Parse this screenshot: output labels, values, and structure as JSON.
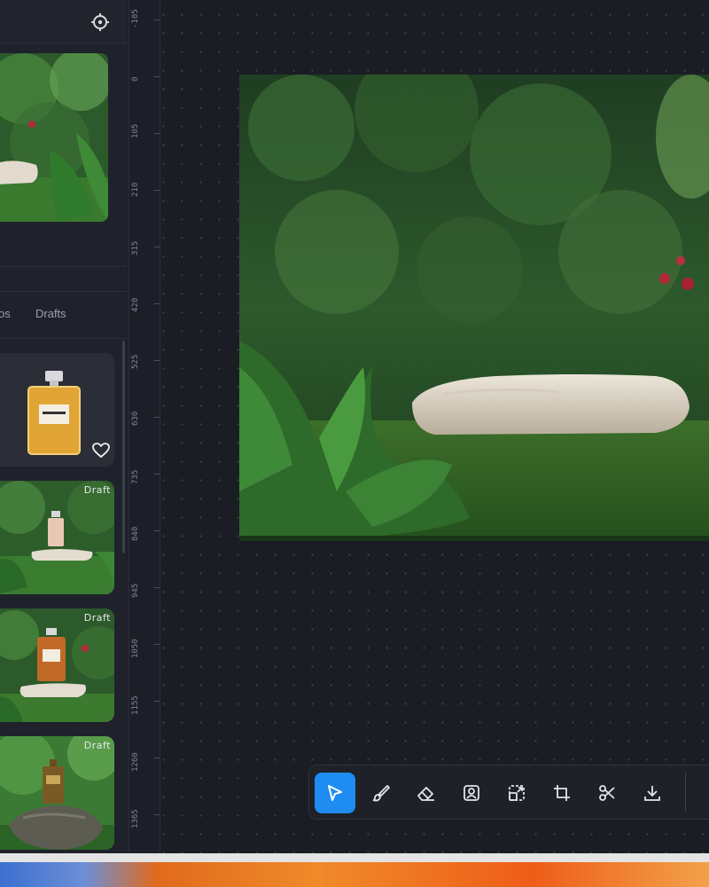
{
  "left_panel": {
    "tabs": [
      "os",
      "Drafts"
    ],
    "cards": [
      {
        "badge": "",
        "favorite_icon": "heart-icon",
        "product": "perfume-bottle"
      },
      {
        "badge": "Draft"
      },
      {
        "badge": "Draft"
      },
      {
        "badge": "Draft"
      }
    ]
  },
  "ruler": {
    "labels": [
      "-105",
      "0",
      "105",
      "210",
      "315",
      "420",
      "525",
      "630",
      "735",
      "840",
      "945",
      "1050",
      "1155",
      "1260",
      "1365"
    ]
  },
  "toolbar": {
    "tools": [
      "select-pointer-icon",
      "brush-icon",
      "eraser-icon",
      "portrait-icon",
      "resize-image-icon",
      "crop-icon",
      "scissors-icon",
      "download-icon"
    ],
    "active_tool": "select-pointer-icon"
  },
  "colors": {
    "accent": "#1e8cf0",
    "background": "#1b1e26",
    "panel": "#1f222b"
  }
}
